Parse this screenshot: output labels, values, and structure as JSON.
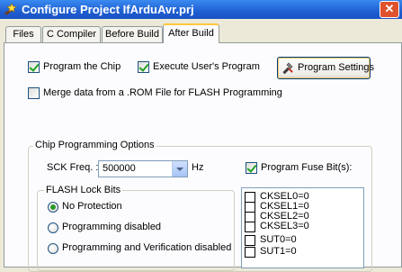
{
  "window": {
    "title": "Configure Project IfArduAvr.prj",
    "close_glyph": "✕"
  },
  "tabs": [
    {
      "label": "Files",
      "active": false
    },
    {
      "label": "C Compiler",
      "active": false
    },
    {
      "label": "Before Build",
      "active": false
    },
    {
      "label": "After Build",
      "active": true
    }
  ],
  "after_build": {
    "program_chip": {
      "label": "Program the Chip",
      "checked": true
    },
    "execute_user_program": {
      "label": "Execute User's Program",
      "checked": true
    },
    "program_settings_button": "Program Settings",
    "merge_rom": {
      "label": "Merge data from a .ROM File for FLASH Programming",
      "checked": false
    }
  },
  "chip_options": {
    "title": "Chip Programming Options",
    "sck_label": "SCK Freq. :",
    "sck_value": "500000",
    "sck_unit": "Hz",
    "program_fuse": {
      "label": "Program Fuse Bit(s):",
      "checked": true
    },
    "flash_lock": {
      "title": "FLASH Lock Bits",
      "options": [
        {
          "label": "No Protection",
          "checked": true
        },
        {
          "label": "Programming disabled",
          "checked": false
        },
        {
          "label": "Programming and Verification disabled",
          "checked": false
        }
      ]
    },
    "fuse_bits": [
      {
        "label": "CKSEL0=0",
        "checked": false
      },
      {
        "label": "CKSEL1=0",
        "checked": false
      },
      {
        "label": "CKSEL2=0",
        "checked": false
      },
      {
        "label": "CKSEL3=0",
        "checked": false
      },
      {
        "label": "SUT0=0",
        "checked": false
      },
      {
        "label": "SUT1=0",
        "checked": false
      }
    ]
  },
  "colors": {
    "titlebar": "#1f5fd1",
    "dialog_bg": "#ece9d8",
    "tab_page_bg": "#fcfcfe",
    "active_tab_accent": "#ffc83c",
    "check_mark": "#21a121"
  },
  "icons": {
    "app_icon": "wand-icon",
    "button_icon": "tools-icon"
  }
}
